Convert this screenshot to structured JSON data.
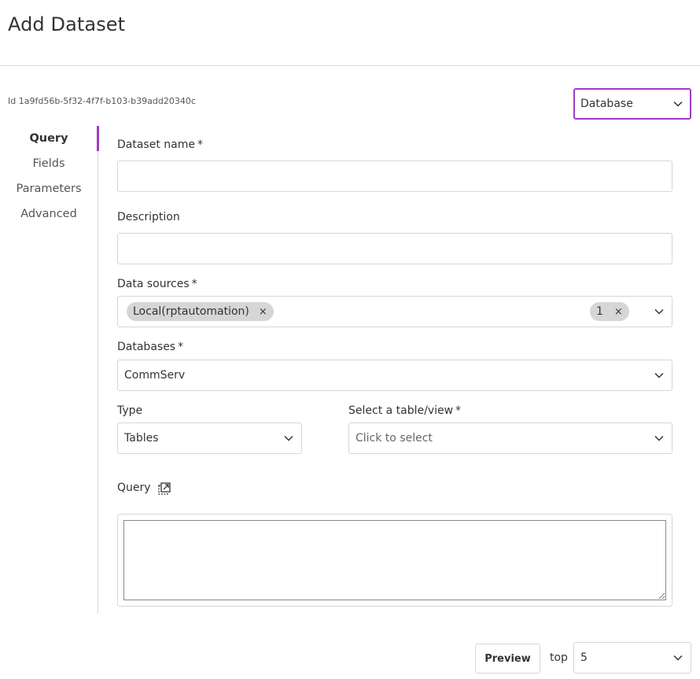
{
  "page": {
    "title": "Add Dataset",
    "id_text": "Id 1a9fd56b-5f32-4f7f-b103-b39add20340c"
  },
  "source_type": {
    "selected": "Database"
  },
  "nav": {
    "items": [
      {
        "label": "Query",
        "active": true
      },
      {
        "label": "Fields",
        "active": false
      },
      {
        "label": "Parameters",
        "active": false
      },
      {
        "label": "Advanced",
        "active": false
      }
    ]
  },
  "form": {
    "dataset_name": {
      "label": "Dataset name",
      "required_mark": "*",
      "value": ""
    },
    "description": {
      "label": "Description",
      "value": ""
    },
    "data_sources": {
      "label": "Data sources",
      "required_mark": "*",
      "chip_label": "Local(rptautomation)",
      "chip_remove": "×",
      "count": "1",
      "count_remove": "×"
    },
    "databases": {
      "label": "Databases",
      "required_mark": "*",
      "selected": "CommServ"
    },
    "type": {
      "label": "Type",
      "selected": "Tables"
    },
    "table_view": {
      "label": "Select a table/view",
      "required_mark": "*",
      "placeholder": "Click to select"
    },
    "query": {
      "label": "Query",
      "value": ""
    }
  },
  "footer": {
    "preview_label": "Preview",
    "top_label": "top",
    "top_selected": "5"
  },
  "colors": {
    "accent": "#9d3cc7",
    "border": "#d6d6d6",
    "chip_bg": "#d6d6d6"
  },
  "icons": {
    "chevron": "chevron-down-icon",
    "expand": "expand-icon",
    "remove": "close-icon"
  }
}
